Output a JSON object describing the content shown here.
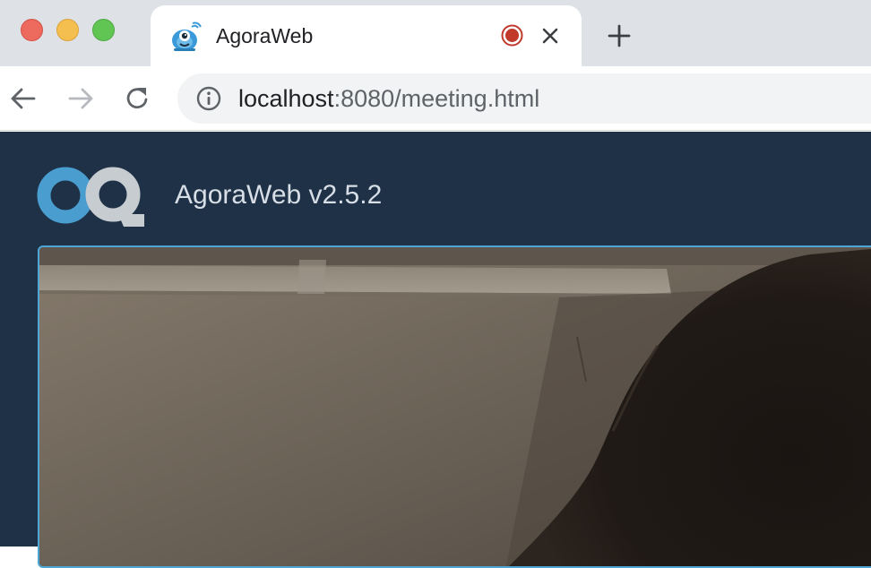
{
  "window": {
    "traffic_lights": [
      "close",
      "minimize",
      "maximize"
    ]
  },
  "tab": {
    "title": "AgoraWeb",
    "favicon": "agora-mascot-icon",
    "recording_indicator": "recording-dot-icon",
    "close_icon": "close-icon"
  },
  "toolbar": {
    "new_tab_icon": "plus-icon",
    "back_icon": "arrow-left-icon",
    "forward_icon": "arrow-right-icon",
    "reload_icon": "reload-icon",
    "site_info_icon": "info-icon",
    "url_host": "localhost",
    "url_rest": ":8080/meeting.html"
  },
  "page": {
    "brand_title": "AgoraWeb v2.5.2",
    "logo": "agora-logo",
    "video_feed": "local-video-stream"
  },
  "colors": {
    "page_background": "#1e3147",
    "video_border": "#4ea6d6",
    "logo_blue": "#4a9dcf",
    "logo_gray": "#c7ccd1",
    "recording_red": "#c0392b"
  }
}
